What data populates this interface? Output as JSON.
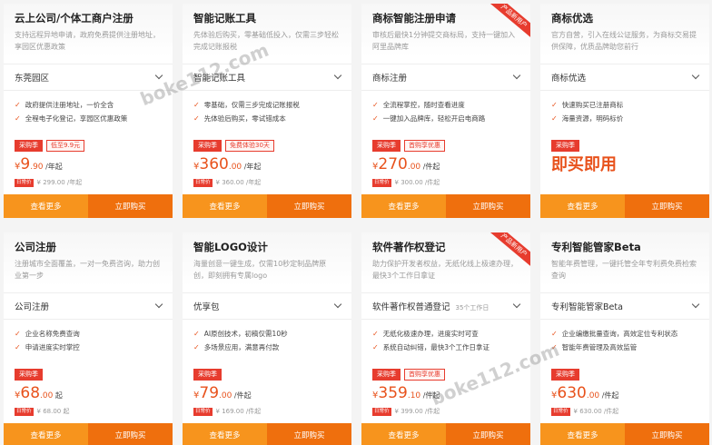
{
  "cards": [
    {
      "title": "云上公司/个体工商户注册",
      "desc": "支持远程异地申请，政府免费提供注册地址，享园区优惠政策",
      "select": "东莞园区",
      "select_sub": "",
      "features": [
        "政府提供注册地址，一价全含",
        "全程电子化登记，享园区优惠政策"
      ],
      "tag_a": "采购季",
      "tag_b": "低至9.9元",
      "price_cur": "¥",
      "price_int": "9",
      "price_dec": ".90",
      "price_unit": " /年起",
      "orig_tag": "日常价",
      "orig": "¥ 299.00 /年起",
      "ribbon": "",
      "btn_more": "查看更多",
      "btn_buy": "立即购买"
    },
    {
      "title": "智能记账工具",
      "desc": "先体验后购买，零基础低投入，仅需三步轻松完成记账报税",
      "select": "智能记账工具",
      "select_sub": "",
      "features": [
        "零基础，仅需三步完成记账报税",
        "先体验后购买，零试错成本"
      ],
      "tag_a": "采购季",
      "tag_b": "免费体验30天",
      "price_cur": "¥",
      "price_int": "360",
      "price_dec": ".00",
      "price_unit": " /年起",
      "orig_tag": "日常价",
      "orig": "¥ 360.00 /年起",
      "ribbon": "",
      "btn_more": "查看更多",
      "btn_buy": "立即购买"
    },
    {
      "title": "商标智能注册申请",
      "desc": "审核后最快1分钟提交商标局，支持一键加入阿里品牌库",
      "select": "商标注册",
      "select_sub": "",
      "features": [
        "全流程掌控，随时查看进度",
        "一键加入品牌库，轻松开启电商路"
      ],
      "tag_a": "采购季",
      "tag_b": "首购享优惠",
      "price_cur": "¥",
      "price_int": "270",
      "price_dec": ".00",
      "price_unit": " /件起",
      "orig_tag": "日常价",
      "orig": "¥ 300.00 /件起",
      "ribbon": "产品新用户",
      "btn_more": "查看更多",
      "btn_buy": "立即购买"
    },
    {
      "title": "商标优选",
      "desc": "官方自营，引入在线公证服务，为商标交易提供保障，优质品牌助您前行",
      "select": "商标优选",
      "select_sub": "",
      "features": [
        "快速购买已注册商标",
        "海量资源，明码标价"
      ],
      "tag_a": "采购季",
      "tag_b": "",
      "big_text": "即买即用",
      "orig_tag": "",
      "orig": "",
      "ribbon": "",
      "btn_more": "查看更多",
      "btn_buy": "立即购买"
    },
    {
      "title": "公司注册",
      "desc": "注册城市全面覆盖，一对一免费咨询，助力创业第一步",
      "select": "公司注册",
      "select_sub": "",
      "features": [
        "企业名称免费查询",
        "申请进度实时掌控"
      ],
      "tag_a": "采购季",
      "tag_b": "",
      "price_cur": "¥",
      "price_int": "68",
      "price_dec": ".00",
      "price_unit": " 起",
      "orig_tag": "日常价",
      "orig": "¥ 68.00 起",
      "ribbon": "",
      "btn_more": "查看更多",
      "btn_buy": "立即购买"
    },
    {
      "title": "智能LOGO设计",
      "desc": "海量创意一键生成，仅需10秒定制品牌原创，即刻拥有专属logo",
      "select": "优享包",
      "select_sub": "",
      "features": [
        "AI原创技术，初稿仅需10秒",
        "多场景应用，满意再付款"
      ],
      "tag_a": "采购季",
      "tag_b": "",
      "price_cur": "¥",
      "price_int": "79",
      "price_dec": ".00",
      "price_unit": " /件起",
      "orig_tag": "日常价",
      "orig": "¥ 169.00 /件起",
      "ribbon": "",
      "btn_more": "查看更多",
      "btn_buy": "立即购买"
    },
    {
      "title": "软件著作权登记",
      "desc": "助力保护开发者权益，无纸化线上极速办理，最快3个工作日拿证",
      "select": "软件著作权普通登记",
      "select_sub": "35个工作日",
      "features": [
        "无纸化极速办理，进度实时可查",
        "系统自动纠错，最快3个工作日拿证"
      ],
      "tag_a": "采购季",
      "tag_b": "首购享优惠",
      "price_cur": "¥",
      "price_int": "359",
      "price_dec": ".10",
      "price_unit": " /件起",
      "orig_tag": "日常价",
      "orig": "¥ 399.00 /件起",
      "ribbon": "产品新用户",
      "btn_more": "查看更多",
      "btn_buy": "立即购买"
    },
    {
      "title": "专利智能管家Beta",
      "desc": "智能年费管理，一键托管全年专利费免费检索查询",
      "select": "专利智能管家Beta",
      "select_sub": "",
      "features": [
        "企业编缴批量查询，高效定位专利状态",
        "智能年费管理及高效监管"
      ],
      "tag_a": "采购季",
      "tag_b": "",
      "price_cur": "¥",
      "price_int": "630",
      "price_dec": ".00",
      "price_unit": " /件起",
      "orig_tag": "日常价",
      "orig": "¥ 630.00 /件起",
      "ribbon": "",
      "btn_more": "查看更多",
      "btn_buy": "立即购买"
    }
  ],
  "watermark": "boke112.com",
  "watermark2": "boke112.com"
}
